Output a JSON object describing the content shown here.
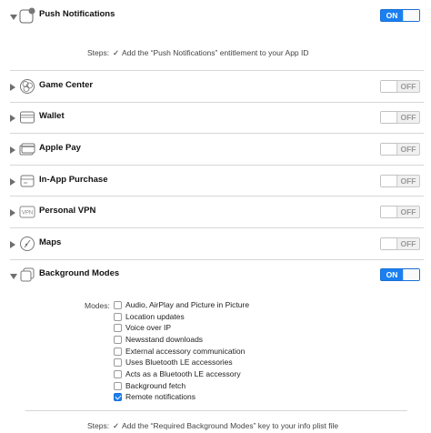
{
  "capabilities": [
    {
      "title": "Push Notifications",
      "toggle": "ON",
      "expanded": true,
      "icon": "push-notifications-icon"
    },
    {
      "title": "Game Center",
      "toggle": "OFF",
      "expanded": false,
      "icon": "game-center-icon"
    },
    {
      "title": "Wallet",
      "toggle": "OFF",
      "expanded": false,
      "icon": "wallet-icon"
    },
    {
      "title": "Apple Pay",
      "toggle": "OFF",
      "expanded": false,
      "icon": "apple-pay-icon"
    },
    {
      "title": "In-App Purchase",
      "toggle": "OFF",
      "expanded": false,
      "icon": "in-app-purchase-icon"
    },
    {
      "title": "Personal VPN",
      "toggle": "OFF",
      "expanded": false,
      "icon": "vpn-icon"
    },
    {
      "title": "Maps",
      "toggle": "OFF",
      "expanded": false,
      "icon": "maps-icon"
    },
    {
      "title": "Background Modes",
      "toggle": "ON",
      "expanded": true,
      "icon": "background-modes-icon"
    }
  ],
  "push_steps": {
    "label": "Steps:",
    "check": "✓",
    "text": "Add the “Push Notifications” entitlement to your App ID"
  },
  "background": {
    "modes_label": "Modes:",
    "modes": [
      {
        "label": "Audio, AirPlay and Picture in Picture",
        "checked": false
      },
      {
        "label": "Location updates",
        "checked": false
      },
      {
        "label": "Voice over IP",
        "checked": false
      },
      {
        "label": "Newsstand downloads",
        "checked": false
      },
      {
        "label": "External accessory communication",
        "checked": false
      },
      {
        "label": "Uses Bluetooth LE accessories",
        "checked": false
      },
      {
        "label": "Acts as a Bluetooth LE accessory",
        "checked": false
      },
      {
        "label": "Background fetch",
        "checked": false
      },
      {
        "label": "Remote notifications",
        "checked": true
      }
    ],
    "steps": {
      "label": "Steps:",
      "check": "✓",
      "text": "Add the “Required Background Modes” key to your info plist file"
    }
  },
  "colors": {
    "accent": "#1a7ff0",
    "divider": "#d6d6d6"
  }
}
